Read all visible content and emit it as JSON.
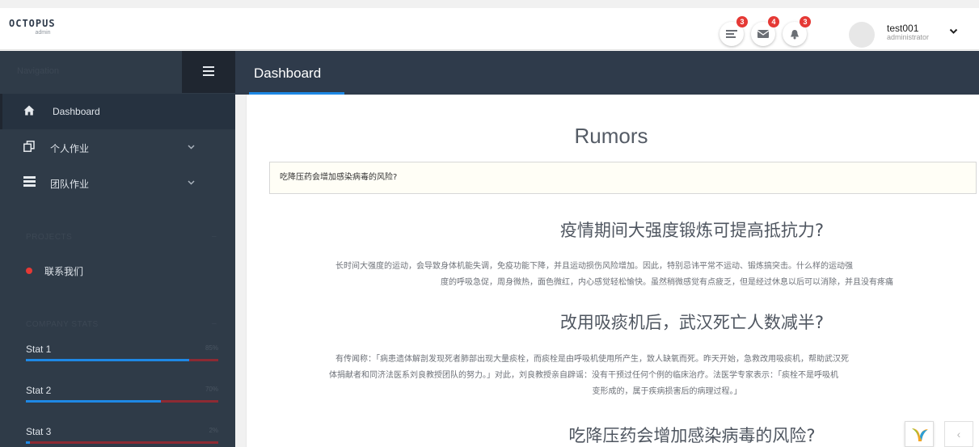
{
  "header": {
    "logo_text": "OCTOPUS",
    "logo_sub": "admin",
    "icons": [
      {
        "name": "tasks-icon",
        "badge": "3"
      },
      {
        "name": "mail-icon",
        "badge": "4"
      },
      {
        "name": "bell-icon",
        "badge": "3"
      }
    ],
    "user_name": "test001",
    "user_role": "administrator"
  },
  "sidebar": {
    "title": "Navigation",
    "items": [
      {
        "label": "Dashboard",
        "icon": "home-icon"
      },
      {
        "label": "个人作业",
        "icon": "copy-icon"
      },
      {
        "label": "团队作业",
        "icon": "list-icon"
      }
    ],
    "projects_title": "PROJECTS",
    "projects_item": "联系我们",
    "stats_title": "COMPANY STATS",
    "stats": [
      {
        "label": "Stat 1",
        "percent": "85%",
        "value": 0.85
      },
      {
        "label": "Stat 2",
        "percent": "70%",
        "value": 0.7
      },
      {
        "label": "Stat 3",
        "percent": "2%",
        "value": 0.02
      }
    ]
  },
  "page": {
    "title": "Dashboard"
  },
  "main": {
    "heading": "Rumors",
    "search_value": "吃降压药会增加感染病毒的风险?",
    "rumors": [
      {
        "title": "疫情期间大强度锻炼可提高抵抗力?",
        "lines": [
          "长时间大强度的运动，会导致身体机能失调，免疫功能下降，并且运动损伤风险增加。因此，特别忌讳平常不运动、锻炼搞突击。什么样的运动强",
          "度的呼吸急促，周身微热，面色微红，内心感觉轻松愉快。虽然稍微感觉有点疲乏，但是经过休息以后可以消除，并且没有疼痛"
        ]
      },
      {
        "title": "改用吸痰机后，武汉死亡人数减半?",
        "lines": [
          "有传闻称：「病患遗体解剖发现死者肺部出现大量痰栓，而痰栓是由呼吸机使用所产生，致人缺氧而死。昨天开始，急救改用吸痰机，帮助武汉死",
          "体捐献者和同济法医系刘良教授团队的努力。」对此，刘良教授亲自辟谣：没有干预过任何个例的临床治疗。法医学专家表示：「痰栓不是呼吸机",
          "变形成的，属于疾病损害后的病理过程。」"
        ]
      },
      {
        "title": "吃降压药会增加感染病毒的风险?"
      }
    ]
  },
  "colors": {
    "sidebar_bg": "#2f3b48",
    "topbar_bg": "#2f3b4b",
    "accent": "#1e88e5",
    "badge": "#e53935"
  }
}
